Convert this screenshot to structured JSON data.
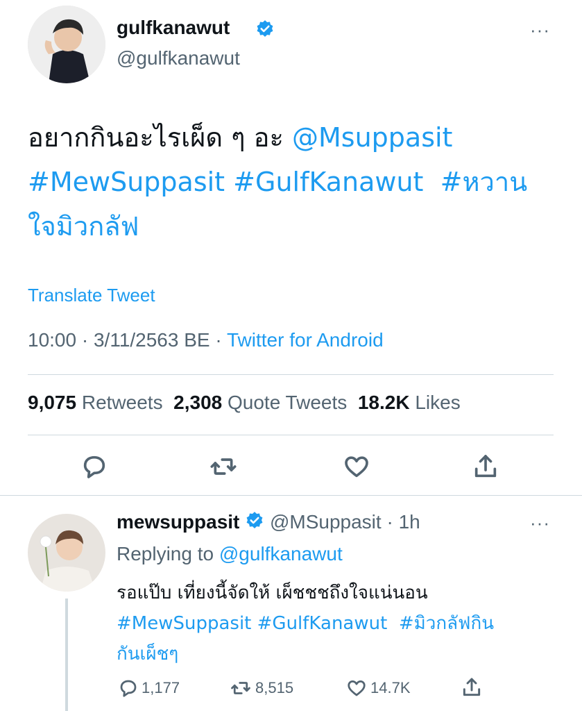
{
  "tweet": {
    "author_name": "gulfkanawut",
    "author_handle": "@gulfkanawut",
    "more_label": "···",
    "text_plain": "อยากกินอะไรเผ็ด ๆ อะ",
    "mention": "@Msuppasit",
    "hashtag1": "#MewSuppasit",
    "hashtag2": "#GulfKanawut",
    "hashtag3a": "#หวาน",
    "hashtag3b": "ใจมิวกลัฟ",
    "translate": "Translate Tweet",
    "time": "10:00",
    "date": "3/11/2563 BE",
    "source": "Twitter for Android",
    "retweets_count": "9,075",
    "retweets_label": "Retweets",
    "quotes_count": "2,308",
    "quotes_label": "Quote Tweets",
    "likes_count": "18.2K",
    "likes_label": "Likes"
  },
  "reply": {
    "author_name": "mewsuppasit",
    "author_handle": "@MSuppasit",
    "age": "1h",
    "more_label": "···",
    "replying_to_label": "Replying to",
    "replying_to_handle": "@gulfkanawut",
    "text_line1": "รอแป๊บ เที่ยงนี้จัดให้ เผ็ชชชถึงใจแน่นอน",
    "hashtag1": "#MewSuppasit",
    "hashtag2": "#GulfKanawut",
    "hashtag3a": "#มิวกลัฟกิน",
    "hashtag3b": "กันเผ็ชๆ",
    "replies": "1,177",
    "retweets": "8,515",
    "likes": "14.7K"
  },
  "colors": {
    "link": "#1d9bf0",
    "secondary_text": "#536471",
    "verified": "#1d9bf0"
  }
}
